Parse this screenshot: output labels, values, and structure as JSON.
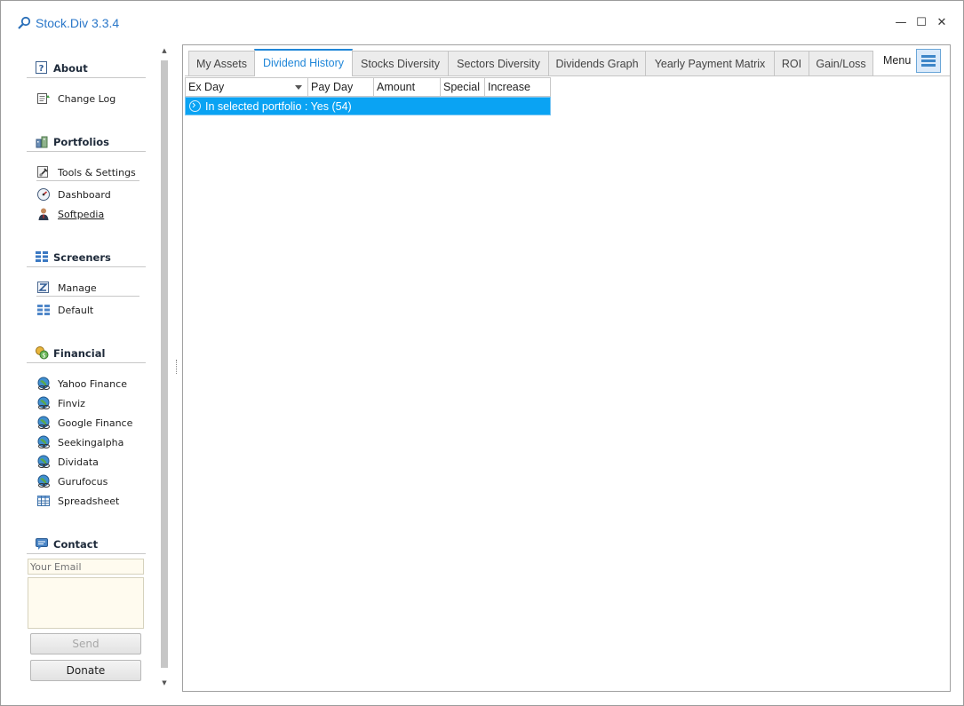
{
  "window": {
    "title": "Stock.Div 3.3.4",
    "controls": {
      "minimize": "—",
      "maximize": "☐",
      "close": "✕"
    }
  },
  "sidebar": {
    "sections": {
      "about": {
        "label": "About",
        "items": [
          {
            "label": "Change Log",
            "icon": "changelog-icon"
          }
        ]
      },
      "portfolios": {
        "label": "Portfolios",
        "items": [
          {
            "label": "Tools & Settings",
            "icon": "tools-icon"
          },
          {
            "label": "Dashboard",
            "icon": "dashboard-icon"
          },
          {
            "label": "Softpedia",
            "icon": "user-icon"
          }
        ]
      },
      "screeners": {
        "label": "Screeners",
        "items": [
          {
            "label": "Manage",
            "icon": "edit-icon"
          },
          {
            "label": "Default",
            "icon": "grid-icon"
          }
        ]
      },
      "financial": {
        "label": "Financial",
        "items": [
          {
            "label": "Yahoo Finance",
            "icon": "globe-icon"
          },
          {
            "label": "Finviz",
            "icon": "globe-icon"
          },
          {
            "label": "Google Finance",
            "icon": "globe-icon"
          },
          {
            "label": "Seekingalpha",
            "icon": "globe-icon"
          },
          {
            "label": "Dividata",
            "icon": "globe-icon"
          },
          {
            "label": "Gurufocus",
            "icon": "globe-icon"
          },
          {
            "label": "Spreadsheet",
            "icon": "spreadsheet-icon"
          }
        ]
      },
      "contact": {
        "label": "Contact"
      }
    },
    "contact_form": {
      "email_placeholder": "Your Email",
      "send_label": "Send",
      "donate_label": "Donate"
    }
  },
  "tabs": [
    {
      "label": "My Assets",
      "active": false
    },
    {
      "label": "Dividend History",
      "active": true
    },
    {
      "label": "Stocks Diversity",
      "active": false
    },
    {
      "label": "Sectors Diversity",
      "active": false
    },
    {
      "label": "Dividends Graph",
      "active": false
    },
    {
      "label": "Yearly Payment Matrix",
      "active": false
    },
    {
      "label": "ROI",
      "active": false
    },
    {
      "label": "Gain/Loss",
      "active": false
    }
  ],
  "menu": {
    "label": "Menu"
  },
  "grid": {
    "columns": [
      "Ex Day",
      "Pay Day",
      "Amount",
      "Special",
      "Increase"
    ],
    "sorted_column": "Ex Day",
    "group_row": "In selected portfolio : Yes (54)"
  },
  "colors": {
    "accent": "#1f86d8",
    "title": "#2a77c9",
    "selection": "#0aa3f3",
    "input_bg": "#fffbef"
  }
}
